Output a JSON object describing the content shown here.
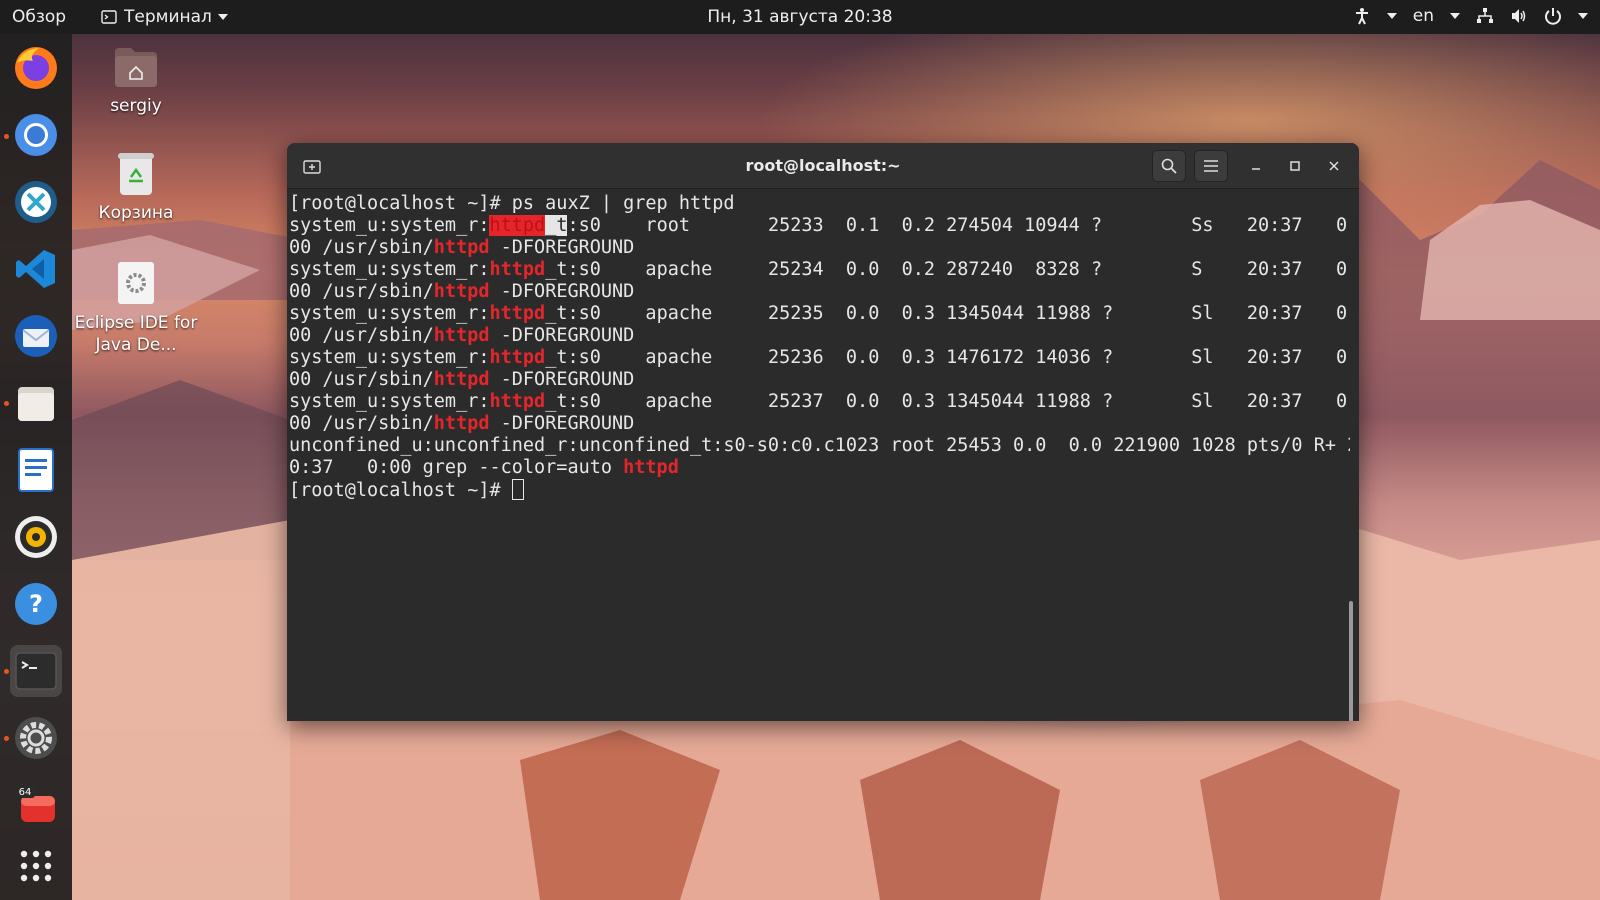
{
  "topbar": {
    "activities": "Обзор",
    "app_menu": "Терминал",
    "clock": "Пн, 31 августа  20:38",
    "language": "en"
  },
  "dock": {
    "items": [
      {
        "name": "firefox-icon"
      },
      {
        "name": "chromium-icon"
      },
      {
        "name": "remmina-icon"
      },
      {
        "name": "vscode-icon"
      },
      {
        "name": "thunderbird-icon"
      },
      {
        "name": "files-icon"
      },
      {
        "name": "writer-icon"
      },
      {
        "name": "rhythmbox-icon"
      },
      {
        "name": "help-icon"
      },
      {
        "name": "terminal-icon"
      },
      {
        "name": "settings-icon"
      },
      {
        "name": "software-icon",
        "badge": "64"
      },
      {
        "name": "show-apps-icon"
      }
    ]
  },
  "desktop": {
    "icons": [
      {
        "label": "sergiy"
      },
      {
        "label": "Корзина"
      },
      {
        "label": "Eclipse IDE for Java De..."
      }
    ]
  },
  "terminal": {
    "title": "root@localhost:~",
    "lines": [
      {
        "parts": [
          {
            "t": "[root@localhost ~]# ps auxZ | grep httpd"
          }
        ]
      },
      {
        "parts": [
          {
            "t": "system_u:system_r:"
          },
          {
            "t": "httpd",
            "c": "sel"
          },
          {
            "t": "_t",
            "c": "curblock"
          },
          {
            "t": ":s0    root       25233  0.1  0.2 274504 10944 ?        Ss   20:37   0:"
          }
        ]
      },
      {
        "parts": [
          {
            "t": "00 /usr/sbin/"
          },
          {
            "t": "httpd",
            "c": "hl"
          },
          {
            "t": " -DFOREGROUND"
          }
        ]
      },
      {
        "parts": [
          {
            "t": "system_u:system_r:"
          },
          {
            "t": "httpd",
            "c": "hl"
          },
          {
            "t": "_t:s0    apache     25234  0.0  0.2 287240  8328 ?        S    20:37   0:"
          }
        ]
      },
      {
        "parts": [
          {
            "t": "00 /usr/sbin/"
          },
          {
            "t": "httpd",
            "c": "hl"
          },
          {
            "t": " -DFOREGROUND"
          }
        ]
      },
      {
        "parts": [
          {
            "t": "system_u:system_r:"
          },
          {
            "t": "httpd",
            "c": "hl"
          },
          {
            "t": "_t:s0    apache     25235  0.0  0.3 1345044 11988 ?       Sl   20:37   0:"
          }
        ]
      },
      {
        "parts": [
          {
            "t": "00 /usr/sbin/"
          },
          {
            "t": "httpd",
            "c": "hl"
          },
          {
            "t": " -DFOREGROUND"
          }
        ]
      },
      {
        "parts": [
          {
            "t": "system_u:system_r:"
          },
          {
            "t": "httpd",
            "c": "hl"
          },
          {
            "t": "_t:s0    apache     25236  0.0  0.3 1476172 14036 ?       Sl   20:37   0:"
          }
        ]
      },
      {
        "parts": [
          {
            "t": "00 /usr/sbin/"
          },
          {
            "t": "httpd",
            "c": "hl"
          },
          {
            "t": " -DFOREGROUND"
          }
        ]
      },
      {
        "parts": [
          {
            "t": "system_u:system_r:"
          },
          {
            "t": "httpd",
            "c": "hl"
          },
          {
            "t": "_t:s0    apache     25237  0.0  0.3 1345044 11988 ?       Sl   20:37   0:"
          }
        ]
      },
      {
        "parts": [
          {
            "t": "00 /usr/sbin/"
          },
          {
            "t": "httpd",
            "c": "hl"
          },
          {
            "t": " -DFOREGROUND"
          }
        ]
      },
      {
        "parts": [
          {
            "t": "unconfined_u:unconfined_r:unconfined_t:s0-s0:c0.c1023 root 25453 0.0  0.0 221900 1028 pts/0 R+ 2"
          }
        ]
      },
      {
        "parts": [
          {
            "t": "0:37   0:00 grep --color=auto "
          },
          {
            "t": "httpd",
            "c": "hl"
          }
        ]
      },
      {
        "parts": [
          {
            "t": "[root@localhost ~]# "
          }
        ],
        "cursor": true
      }
    ]
  }
}
